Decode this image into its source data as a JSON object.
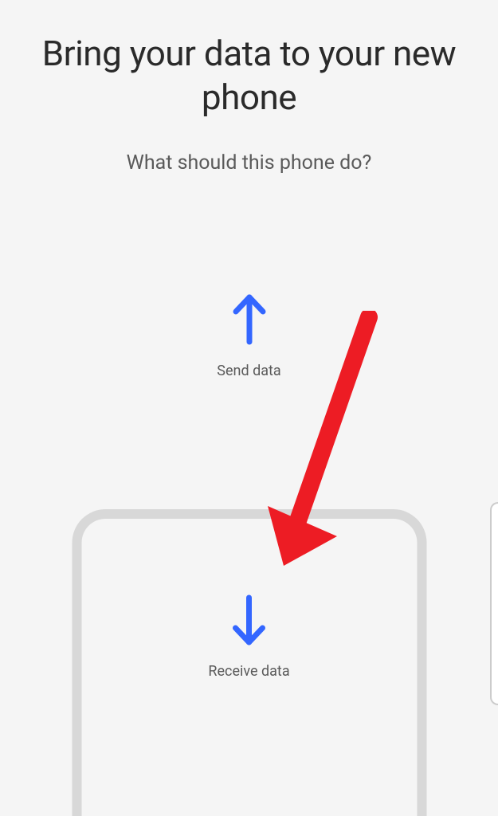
{
  "title": "Bring your data to your new phone",
  "subtitle": "What should this phone do?",
  "options": {
    "send": {
      "label": "Send data"
    },
    "receive": {
      "label": "Receive data"
    }
  },
  "colors": {
    "arrow_blue": "#3366ff",
    "annotation_red": "#ed1c24"
  }
}
